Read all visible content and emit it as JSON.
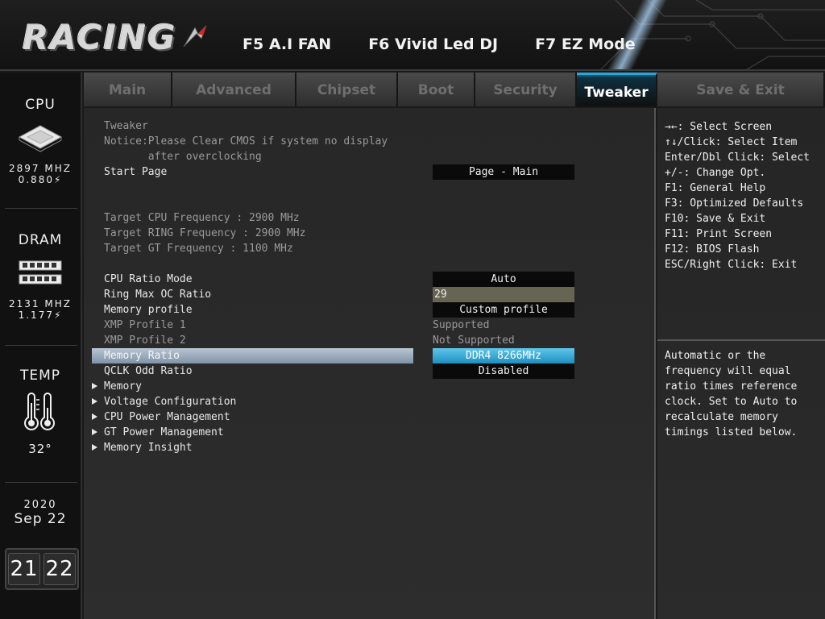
{
  "header": {
    "logo_text": "RACING",
    "hotkeys": [
      "F5 A.I FAN",
      "F6 Vivid Led DJ",
      "F7 EZ Mode"
    ]
  },
  "left_panel": {
    "cpu": {
      "title": "CPU",
      "freq": "2897 MHZ",
      "volt": "0.880⚡"
    },
    "dram": {
      "title": "DRAM",
      "freq": "2131 MHZ",
      "volt": "1.177⚡"
    },
    "temp": {
      "title": "TEMP",
      "value": "32°"
    },
    "date": {
      "year": "2020",
      "month_day": "Sep 22"
    },
    "time": {
      "hour": "21",
      "minute": "22"
    }
  },
  "tabs": [
    "Main",
    "Advanced",
    "Chipset",
    "Boot",
    "Security",
    "Tweaker",
    "Save & Exit"
  ],
  "active_tab": "Tweaker",
  "main": {
    "section_title": "Tweaker",
    "notice_line1": "Notice:Please Clear CMOS if system no display",
    "notice_line2": "       after overclocking",
    "start_page": {
      "label": "Start Page",
      "value": "Page - Main"
    },
    "target_cpu": "Target CPU Frequency : 2900 MHz",
    "target_ring": "Target RING Frequency : 2900 MHz",
    "target_gt": "Target GT Frequency : 1100 MHz",
    "cpu_ratio_mode": {
      "label": "CPU Ratio Mode",
      "value": "Auto"
    },
    "ring_max_oc": {
      "label": "Ring Max OC Ratio",
      "value": "29"
    },
    "memory_profile": {
      "label": "Memory profile",
      "value": "Custom profile"
    },
    "xmp1": {
      "label": "XMP Profile 1",
      "value": "Supported"
    },
    "xmp2": {
      "label": "XMP Profile 2",
      "value": "Not Supported"
    },
    "memory_ratio": {
      "label": "Memory Ratio",
      "value": "DDR4 8266MHz"
    },
    "qclk": {
      "label": "QCLK Odd Ratio",
      "value": "Disabled"
    },
    "submenus": [
      "Memory",
      "Voltage Configuration",
      "CPU Power Management",
      "GT Power Management",
      "Memory Insight"
    ]
  },
  "help": {
    "keys": "→←: Select Screen\n↑↓/Click: Select Item\nEnter/Dbl Click: Select\n+/-: Change Opt.\nF1: General Help\nF3: Optimized Defaults\nF10: Save & Exit\nF11: Print Screen\nF12: BIOS Flash\nESC/Right Click: Exit",
    "description": "Automatic or the frequency will equal ratio times reference clock. Set to Auto to recalculate memory timings listed below."
  },
  "colors": {
    "accent": "#2aa5d8",
    "selected_value": "#1f8fbf",
    "highlight_row": "#9aabbd"
  }
}
